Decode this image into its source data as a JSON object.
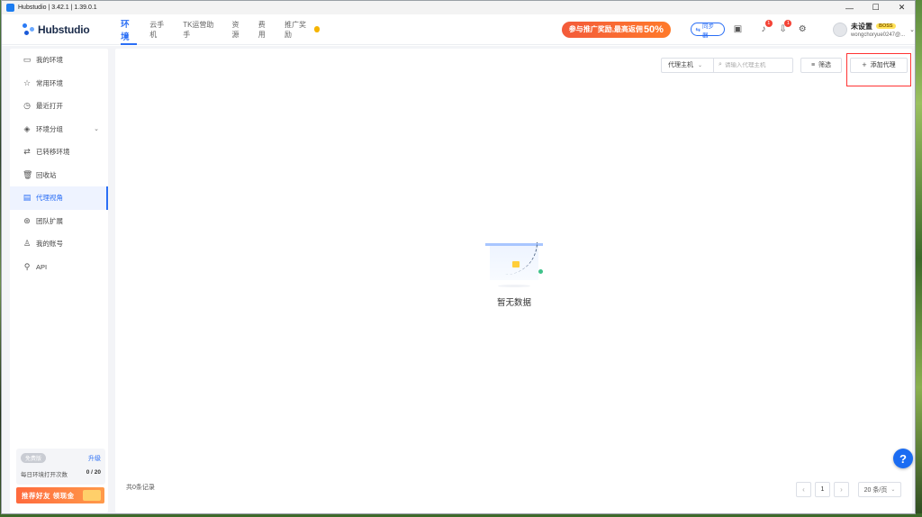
{
  "window": {
    "title": "Hubstudio | 3.42.1 | 1.39.0.1",
    "minimize": "—",
    "maximize": "☐",
    "close": "✕"
  },
  "header": {
    "logo_text": "Hubstudio",
    "nav": [
      {
        "label": "环境",
        "active": true
      },
      {
        "label": "云手机"
      },
      {
        "label": "TK运营助手"
      },
      {
        "label": "资源"
      },
      {
        "label": "费用"
      },
      {
        "label": "推广奖励"
      }
    ],
    "promo_text": "参与推广奖励,最高返佣",
    "promo_percent": "50%",
    "sync_label": "同步器",
    "notification_badge": "1",
    "update_badge": "1",
    "user_name": "未设置",
    "user_role": "BOSS",
    "user_email": "wongchoryue0247@..."
  },
  "sidebar": {
    "items": [
      {
        "label": "我的环境",
        "icon": "monitor-icon"
      },
      {
        "label": "常用环境",
        "icon": "star-icon"
      },
      {
        "label": "最近打开",
        "icon": "clock-icon"
      },
      {
        "label": "环境分组",
        "icon": "layers-icon",
        "expandable": true
      },
      {
        "label": "已转移环境",
        "icon": "transfer-icon"
      },
      {
        "label": "回收站",
        "icon": "trash-icon"
      },
      {
        "label": "代理视角",
        "icon": "proxy-icon",
        "active": true
      },
      {
        "label": "团队扩展",
        "icon": "team-icon"
      },
      {
        "label": "我的账号",
        "icon": "user-icon"
      },
      {
        "label": "API",
        "icon": "api-icon"
      }
    ],
    "plan": {
      "badge": "免费版",
      "upgrade": "升级",
      "daily_label": "每日环境打开次数",
      "daily_count": "0 / 20"
    },
    "refer_banner": "推荐好友 领现金"
  },
  "main": {
    "proxy_select": "代理主机",
    "search_placeholder": "请输入代理主机",
    "filter_label": "筛选",
    "add_proxy_label": "添加代理",
    "empty_text": "暂无数据",
    "total_text": "共0条记录",
    "pagination": {
      "current_page": "1",
      "page_size": "20 条/页",
      "prev": "‹",
      "next": "›"
    }
  },
  "help_label": "?",
  "colors": {
    "accent": "#2a6ef5",
    "promo": "#f35a3a",
    "highlight_box": "#ff3333"
  }
}
